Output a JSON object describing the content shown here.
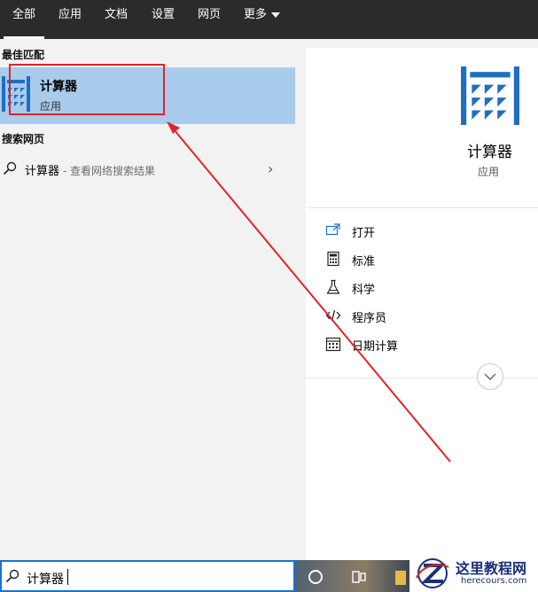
{
  "tabs": [
    {
      "label": "全部",
      "active": true
    },
    {
      "label": "应用"
    },
    {
      "label": "文档"
    },
    {
      "label": "设置"
    },
    {
      "label": "网页"
    },
    {
      "label": "更多"
    }
  ],
  "left": {
    "best_match_title": "最佳匹配",
    "best_match": {
      "name": "计算器",
      "type": "应用",
      "icon": "calculator-icon"
    },
    "web_section_title": "搜索网页",
    "web_query": "计算器",
    "web_hint": " - 查看网络搜索结果"
  },
  "right": {
    "app_name": "计算器",
    "app_type": "应用",
    "actions": [
      {
        "label": "打开",
        "icon": "open-icon"
      },
      {
        "label": "标准",
        "icon": "calculator-standard-icon"
      },
      {
        "label": "科学",
        "icon": "flask-icon"
      },
      {
        "label": "程序员",
        "icon": "code-icon"
      },
      {
        "label": "日期计算",
        "icon": "calendar-icon"
      }
    ]
  },
  "search": {
    "value": "计算器"
  },
  "watermark": {
    "title": "这里教程网",
    "url": "herecours.com"
  },
  "colors": {
    "accent": "#1a73d1",
    "selection": "#a9cbec",
    "annotation": "#e0242b",
    "topbar": "#2b2b2b"
  }
}
